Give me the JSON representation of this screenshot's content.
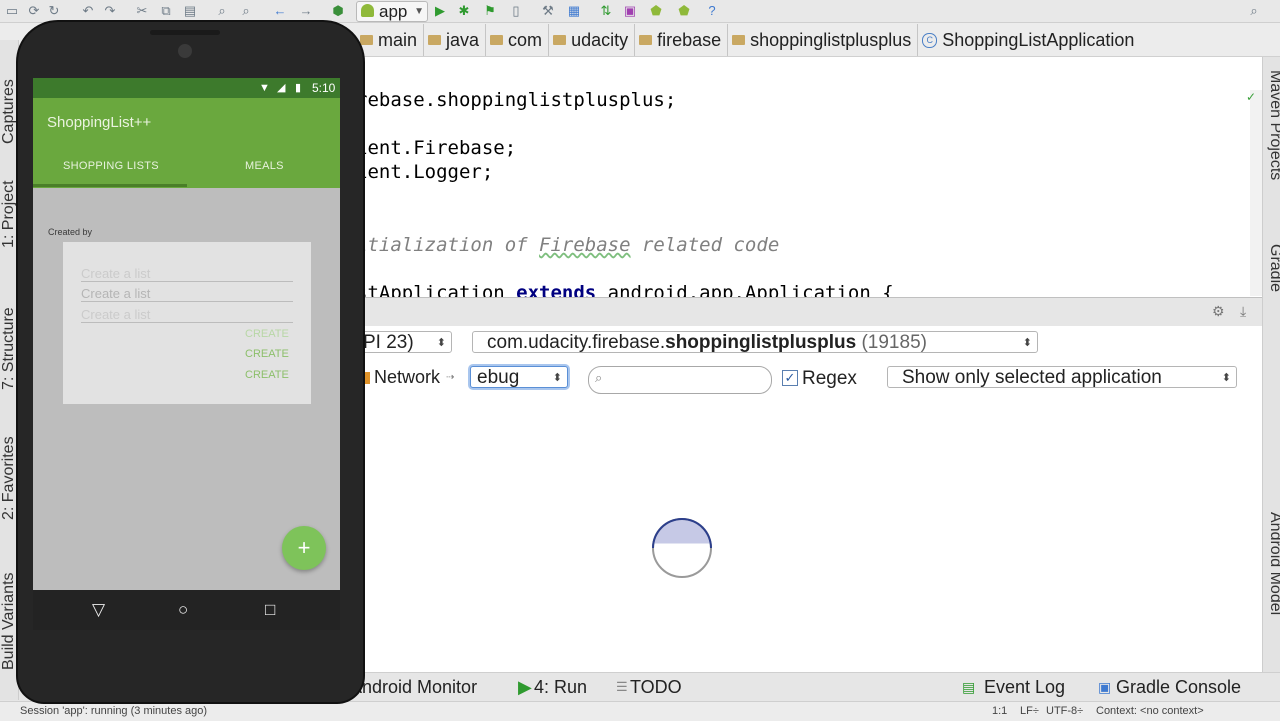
{
  "toolbar": {
    "run_config": "app",
    "icons": [
      "save-all-icon",
      "sync-icon",
      "refresh-icon",
      "undo-icon",
      "redo-icon",
      "cut-icon",
      "copy-icon",
      "paste-icon",
      "find-icon",
      "replace-icon",
      "back-icon",
      "forward-icon",
      "make-icon",
      "run-icon",
      "debug-icon",
      "attach-icon",
      "stop-icon",
      "sdk-manager-icon",
      "avd-manager-icon",
      "sync-gradle-icon",
      "device-monitor-icon",
      "android-icon",
      "help-icon"
    ]
  },
  "breadcrumb": [
    "main",
    "java",
    "com",
    "udacity",
    "firebase",
    "shoppinglistplusplus",
    "ShoppingListApplication"
  ],
  "editor": {
    "line1": "rebase.shoppinglistplusplus;",
    "line2": "ient.Firebase;",
    "line3": "ient.Logger;",
    "comment_prefix": "itialization of ",
    "comment_link": "Firebase",
    "comment_suffix": " related code",
    "line5_a": "stApplication ",
    "line5_kw": "extends",
    "line5_b": " android.app.Application {"
  },
  "right_sidebar": [
    "Maven Projects",
    "Gradle",
    "Android Model"
  ],
  "left_sidebar": [
    "Captures",
    "1: Project",
    "7: Structure",
    "2: Favorites",
    "Build Variants"
  ],
  "monitor": {
    "device_combo": "PI 23)",
    "process_prefix": "com.udacity.firebase.",
    "process_bold": "shoppinglistplusplus",
    "process_pid": "(19185)",
    "network_tab": "Network",
    "log_level": "ebug",
    "search_placeholder": "",
    "regex_label": "Regex",
    "regex_checked": true,
    "filter": "Show only selected application"
  },
  "bottom_tools": {
    "android_monitor": "Android Monitor",
    "run": "4: Run",
    "todo": "TODO",
    "event_log": "Event Log",
    "gradle_console": "Gradle Console"
  },
  "status": {
    "session": "Session 'app': running (3 minutes ago)",
    "position": "1:1",
    "line_sep": "LF÷",
    "encoding": "UTF-8÷",
    "context": "Context: <no context>"
  },
  "phone": {
    "time": "5:10",
    "app_title": "ShoppingList++",
    "tab_lists": "SHOPPING LISTS",
    "tab_meals": "MEALS",
    "created_by": "Created by",
    "input_placeholder": "Create a list",
    "create_label": "CREATE",
    "fab": "+"
  },
  "colors": {
    "app_bar": "#6aa83e",
    "accent": "#7ec35a",
    "keyword": "#000080",
    "comment": "#808080"
  }
}
